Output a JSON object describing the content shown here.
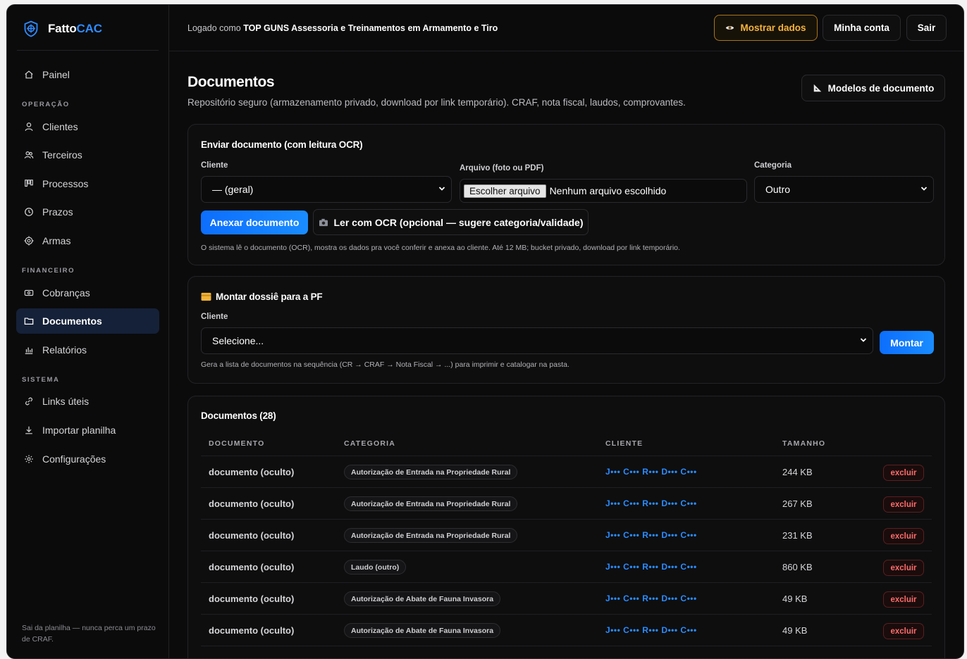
{
  "brand": {
    "name_part1": "Fatto",
    "name_part2": "CAC",
    "accent": "#2f8cff"
  },
  "sidebar": {
    "items": [
      {
        "label": "Painel",
        "icon": "home-icon"
      },
      {
        "label": "Clientes",
        "icon": "user-icon"
      },
      {
        "label": "Terceiros",
        "icon": "users-icon"
      },
      {
        "label": "Processos",
        "icon": "kanban-icon"
      },
      {
        "label": "Prazos",
        "icon": "clock-icon"
      },
      {
        "label": "Armas",
        "icon": "target-icon"
      },
      {
        "label": "Cobranças",
        "icon": "money-icon"
      },
      {
        "label": "Documentos",
        "icon": "folder-icon",
        "active": true
      },
      {
        "label": "Relatórios",
        "icon": "bar-chart-icon"
      },
      {
        "label": "Links úteis",
        "icon": "link-icon"
      },
      {
        "label": "Importar planilha",
        "icon": "download-icon"
      },
      {
        "label": "Configurações",
        "icon": "gear-icon"
      }
    ],
    "sections": {
      "operacao": "OPERAÇÃO",
      "financeiro": "FINANCEIRO",
      "sistema": "SISTEMA"
    },
    "footer": "Sai da planilha — nunca perca um prazo de CRAF."
  },
  "topbar": {
    "logged_prefix": "Logado como",
    "logged_name": "TOP GUNS Assessoria e Treinamentos em Armamento e Tiro",
    "show_data": "Mostrar dados",
    "account": "Minha conta",
    "logout": "Sair"
  },
  "page": {
    "title": "Documentos",
    "subtitle": "Repositório seguro (armazenamento privado, download por link temporário). CRAF, nota fiscal, laudos, comprovantes.",
    "models_button": "Modelos de documento"
  },
  "upload": {
    "title": "Enviar documento (com leitura OCR)",
    "client_label": "Cliente",
    "client_value": "— (geral)",
    "file_label": "Arquivo (foto ou PDF)",
    "file_button": "Escolher arquivo",
    "file_status": "Nenhum arquivo escolhido",
    "category_label": "Categoria",
    "category_value": "Outro",
    "attach_button": "Anexar documento",
    "ocr_button": "Ler com OCR (opcional — sugere categoria/validade)",
    "hint": "O sistema lê o documento (OCR), mostra os dados pra você conferir e anexa ao cliente. Até 12 MB; bucket privado, download por link temporário."
  },
  "dossier": {
    "title": "Montar dossiê para a PF",
    "client_label": "Cliente",
    "client_value": "Selecione...",
    "button": "Montar",
    "hint": "Gera a lista de documentos na sequência (CR → CRAF → Nota Fiscal → ...) para imprimir e catalogar na pasta."
  },
  "documents": {
    "title": "Documentos (28)",
    "columns": [
      "DOCUMENTO",
      "CATEGORIA",
      "CLIENTE",
      "TAMANHO"
    ],
    "delete_label": "excluir",
    "rows": [
      {
        "doc": "documento (oculto)",
        "category": "Autorização de Entrada na Propriedade Rural",
        "client": "J••• C••• R••• D••• C•••",
        "size": "244 KB"
      },
      {
        "doc": "documento (oculto)",
        "category": "Autorização de Entrada na Propriedade Rural",
        "client": "J••• C••• R••• D••• C•••",
        "size": "267 KB"
      },
      {
        "doc": "documento (oculto)",
        "category": "Autorização de Entrada na Propriedade Rural",
        "client": "J••• C••• R••• D••• C•••",
        "size": "231 KB"
      },
      {
        "doc": "documento (oculto)",
        "category": "Laudo (outro)",
        "client": "J••• C••• R••• D••• C•••",
        "size": "860 KB"
      },
      {
        "doc": "documento (oculto)",
        "category": "Autorização de Abate de Fauna Invasora",
        "client": "J••• C••• R••• D••• C•••",
        "size": "49 KB"
      },
      {
        "doc": "documento (oculto)",
        "category": "Autorização de Abate de Fauna Invasora",
        "client": "J••• C••• R••• D••• C•••",
        "size": "49 KB"
      }
    ]
  }
}
